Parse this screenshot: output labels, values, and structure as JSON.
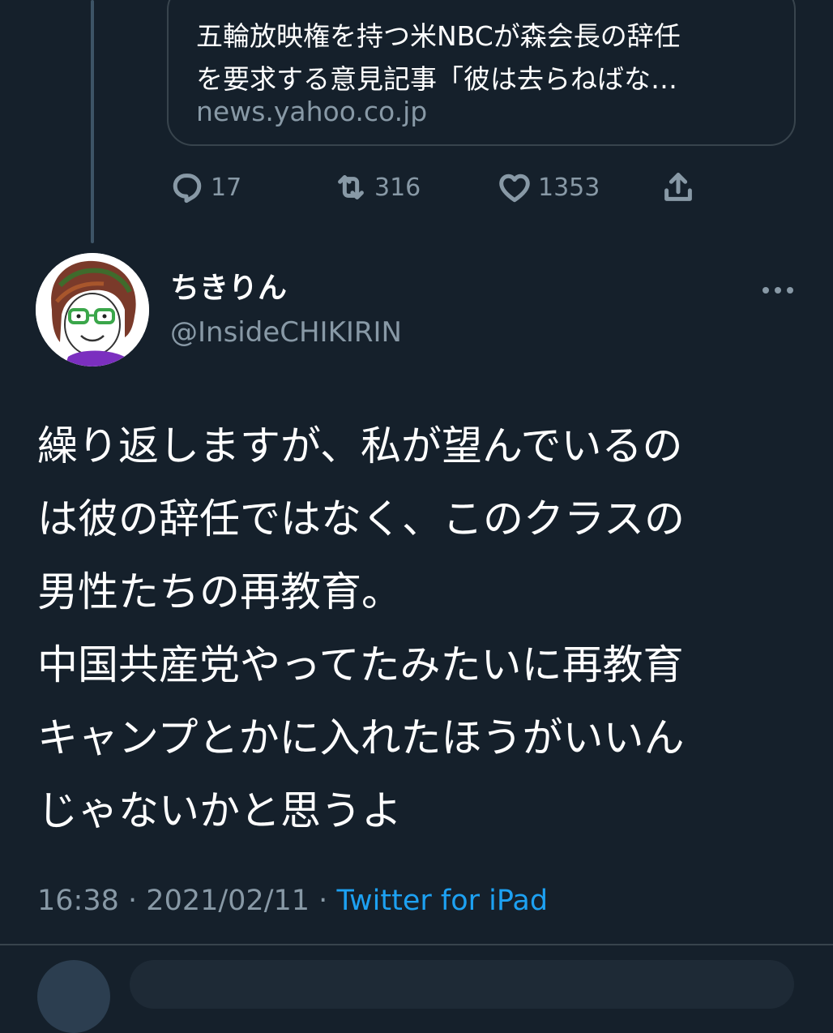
{
  "link_card": {
    "title_line1": "五輪放映権を持つ米NBCが森会長の辞任",
    "title_line2": "を要求する意見記事「彼は去らねばな…",
    "domain": "news.yahoo.co.jp"
  },
  "actions": {
    "reply_count": "17",
    "retweet_count": "316",
    "like_count": "1353"
  },
  "tweet": {
    "display_name": "ちきりん",
    "handle": "@InsideCHIKIRIN",
    "text_lines": [
      "繰り返しますが、私が望んでいるの",
      "は彼の辞任ではなく、このクラスの",
      "男性たちの再教育。",
      "中国共産党やってたみたいに再教育",
      "キャンプとかに入れたほうがいいん",
      "じゃないかと思うよ"
    ],
    "time": "16:38",
    "date": "2021/02/11",
    "separator": "·",
    "source": "Twitter for iPad"
  },
  "icons": {
    "reply": "speech-bubble-icon",
    "retweet": "retweet-arrows-icon",
    "like": "heart-icon",
    "share": "share-upload-icon",
    "more": "more-dots-icon"
  },
  "colors": {
    "background": "#15202b",
    "secondary_text": "#8899a6",
    "link": "#1da1f2",
    "border": "#38444d"
  }
}
